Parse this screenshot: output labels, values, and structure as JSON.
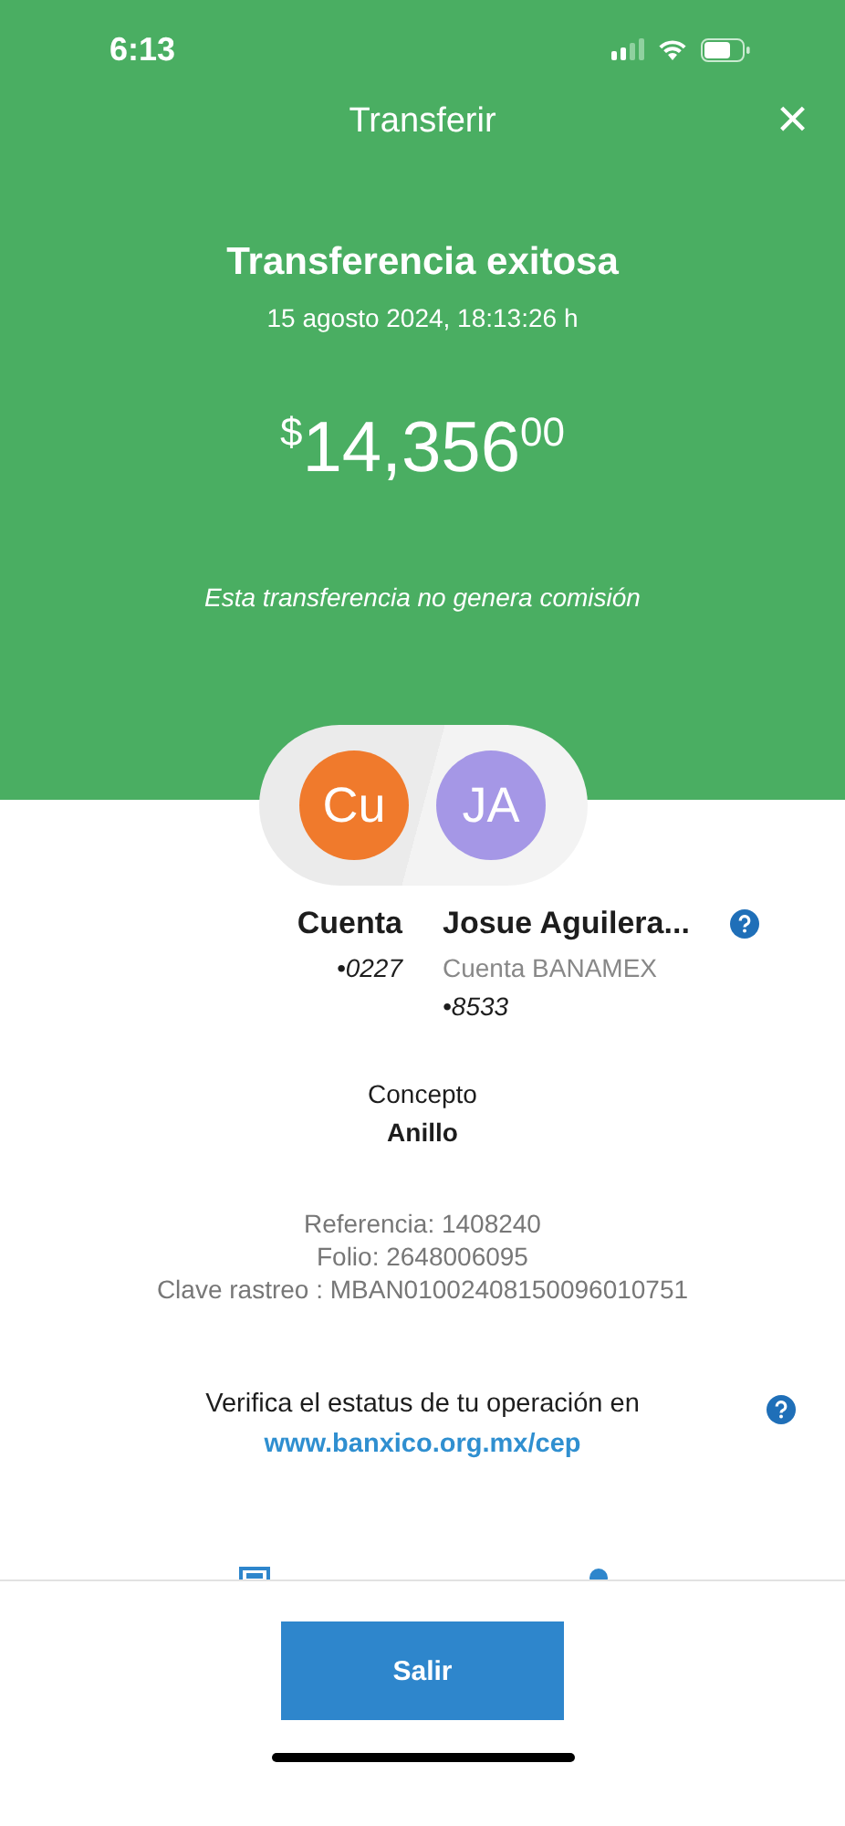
{
  "status_bar": {
    "time": "6:13"
  },
  "header": {
    "title": "Transferir",
    "close": "×"
  },
  "result": {
    "heading": "Transferencia exitosa",
    "datetime": "15 agosto 2024, 18:13:26 h",
    "amount": {
      "currency": "$",
      "integer": "14,356",
      "cents": "00"
    },
    "note": "Esta transferencia no genera comisión"
  },
  "parties": [
    {
      "initials": "Cu",
      "color": "#f07a2c",
      "name": "Cuenta",
      "account": "•0227"
    },
    {
      "initials": "JA",
      "color": "#a597e6",
      "name": "Josue Aguilera...",
      "bank": "Cuenta BANAMEX",
      "account": "•8533"
    }
  ],
  "concept": {
    "label": "Concepto",
    "value": "Anillo"
  },
  "references": [
    "Referencia: 1408240",
    "Folio: 2648006095",
    "Clave rastreo : MBAN01002408150096010751"
  ],
  "verify": {
    "text": "Verifica el estatus de tu operación en",
    "link": "www.banxico.org.mx/cep"
  },
  "footer": {
    "button": "Salir"
  }
}
